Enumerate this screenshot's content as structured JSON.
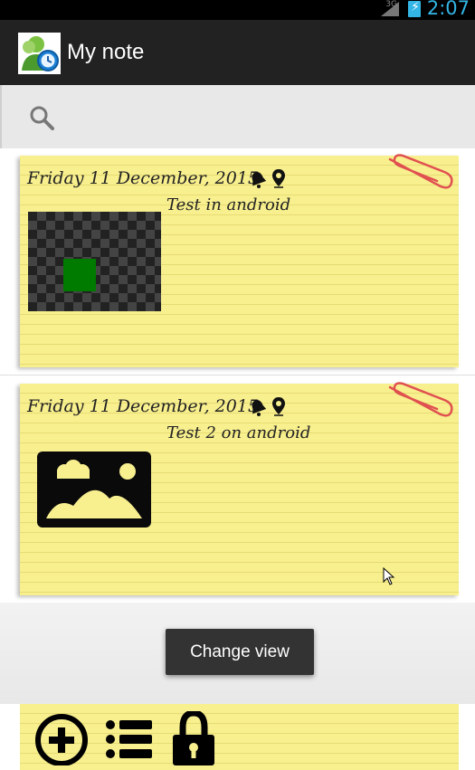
{
  "status_bar": {
    "network": "3G",
    "time": "2:07"
  },
  "action_bar": {
    "title": "My note",
    "icon": "contacts-clock-icon"
  },
  "search": {
    "icon": "search-icon"
  },
  "notes": [
    {
      "date": "Friday 11 December, 2015",
      "title": "Test in android",
      "has_reminder": true,
      "has_location": true,
      "thumbnail": "checker-green-image"
    },
    {
      "date": "Friday 11 December, 2015",
      "title": "Test 2 on android",
      "has_reminder": true,
      "has_location": true,
      "thumbnail": "image-placeholder-icon"
    }
  ],
  "toast": {
    "text": "Change view"
  },
  "bottom_bar": {
    "buttons": [
      {
        "icon": "add-circle-icon"
      },
      {
        "icon": "list-view-icon"
      },
      {
        "icon": "lock-icon"
      }
    ]
  },
  "colors": {
    "paper": "#f8ef8f",
    "action_bar": "#222222",
    "status_accent": "#33b5e5",
    "clip": "#e05050"
  }
}
